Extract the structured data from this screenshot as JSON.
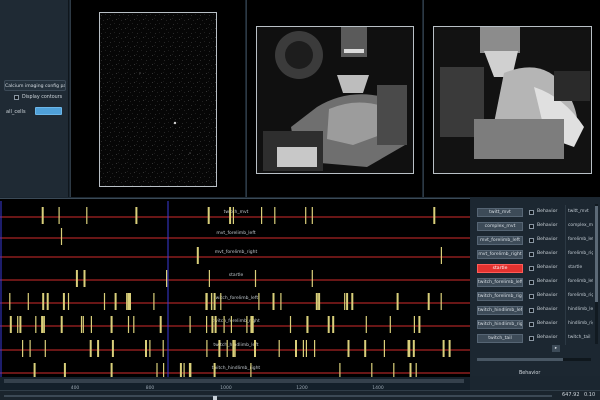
{
  "config_panel": {
    "title": "Calcium imaging config panel",
    "display_contours_label": "Display contours",
    "cells_label": "all_cells"
  },
  "timeline": {
    "x_ticks": [
      "400",
      "800",
      "1000",
      "1200",
      "1400"
    ],
    "tracks": [
      "twitch_mvt",
      "mvt_forelimb_left",
      "mvt_forelimb_right",
      "startle",
      "twitch_forelimb_left",
      "twitch_forelimb_right",
      "twitch_hindlimb_left",
      "twitch_hindlimb_right"
    ],
    "colors": {
      "background": "#000000",
      "track_line": "#d22b2b",
      "event": "#d9cf7a",
      "cursor": "#3a3ad8"
    }
  },
  "behavior_panel": {
    "rows": [
      {
        "label": "twitt_mvt",
        "checkbox": "Behavior",
        "active": false
      },
      {
        "label": "complex_mvt",
        "checkbox": "Behavior",
        "active": false
      },
      {
        "label": "mvt_forelimb_left",
        "checkbox": "Behavior",
        "active": false
      },
      {
        "label": "mvt_forelimb_right",
        "checkbox": "Behavior",
        "active": false
      },
      {
        "label": "startle",
        "checkbox": "Behavior",
        "active": true
      },
      {
        "label": "twitch_forelimb_left",
        "checkbox": "Behavior",
        "active": false
      },
      {
        "label": "twitch_forelimb_right",
        "checkbox": "Behavior",
        "active": false
      },
      {
        "label": "twitch_hindlimb_left",
        "checkbox": "Behavior",
        "active": false
      },
      {
        "label": "twitch_hindlimb_right",
        "checkbox": "Behavior",
        "active": false
      },
      {
        "label": "twitch_tail",
        "checkbox": "Behavior",
        "active": false
      }
    ],
    "list": [
      "twitt_mvt",
      "complex_mvt",
      "forelimb_left",
      "forelimb_right",
      "startle",
      "forelimb_left",
      "forelimb_right",
      "hindlimb_left",
      "hindlimb_right",
      "twitch_tail"
    ],
    "scroll_arrow": "▸",
    "footer_label": "Behavior",
    "colors": {
      "active": "#e3322f",
      "button": "#3d4b58"
    }
  },
  "status": {
    "time_value": "647.92",
    "rate_value": "0.10"
  }
}
